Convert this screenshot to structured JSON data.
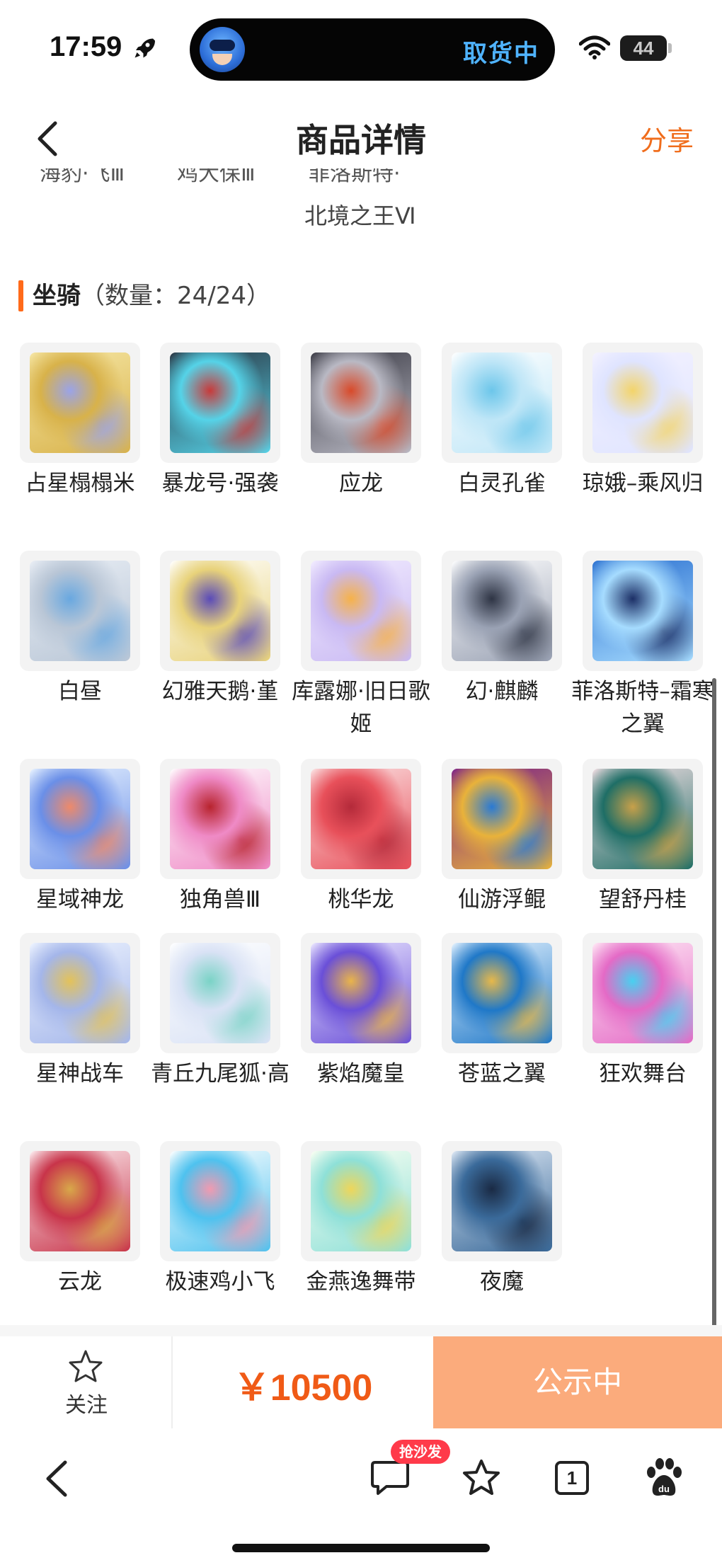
{
  "status_bar": {
    "time": "17:59",
    "island_text": "取货中",
    "battery": "44"
  },
  "nav": {
    "title": "商品详情",
    "share_label": "分享"
  },
  "previous_section": {
    "cut_items": [
      "海豹·飞Ⅲ",
      "鸡大保Ⅲ",
      "菲洛斯特·"
    ],
    "last_line": "北境之王Ⅵ"
  },
  "section": {
    "title": "坐骑",
    "count_label": "（数量：",
    "count": "24/24",
    "count_close": "）"
  },
  "mounts": [
    {
      "name": "占星榻榻米",
      "colors": [
        "#f6e7a6",
        "#d8b24a",
        "#9aa3e8"
      ]
    },
    {
      "name": "暴龙号·强袭",
      "colors": [
        "#2a3340",
        "#55d3e8",
        "#c83a3a"
      ]
    },
    {
      "name": "应龙",
      "colors": [
        "#3a3a44",
        "#b9b9c4",
        "#d84a2a"
      ]
    },
    {
      "name": "白灵孔雀",
      "colors": [
        "#ffffff",
        "#bfe6f7",
        "#6cc6ea"
      ]
    },
    {
      "name": "琼娥–乘风归",
      "colors": [
        "#f4f2ff",
        "#dfe4ff",
        "#f3d46a"
      ]
    },
    {
      "name": "白昼",
      "colors": [
        "#e9eef5",
        "#b9c6d6",
        "#69a8e0"
      ]
    },
    {
      "name": "幻雅天鹅·堇",
      "colors": [
        "#ffffff",
        "#e8d27a",
        "#5a4bb8"
      ]
    },
    {
      "name": "库露娜·旧日歌姬",
      "colors": [
        "#f2ecff",
        "#c9b9f3",
        "#f6b24a"
      ]
    },
    {
      "name": "幻·麒麟",
      "colors": [
        "#ffffff",
        "#9aa2b4",
        "#2e3444"
      ]
    },
    {
      "name": "菲洛斯特–霜寒之翼",
      "colors": [
        "#2a6fd0",
        "#a6dcff",
        "#1c2f66"
      ]
    },
    {
      "name": "星域神龙",
      "colors": [
        "#e7f2ff",
        "#6a8fe8",
        "#ee8a6a"
      ]
    },
    {
      "name": "独角兽Ⅲ",
      "colors": [
        "#ffffff",
        "#ef8ac6",
        "#b8242e"
      ]
    },
    {
      "name": "桃华龙",
      "colors": [
        "#fbe3e4",
        "#e8505a",
        "#b42a3a"
      ]
    },
    {
      "name": "仙游浮鲲",
      "colors": [
        "#7a1f8a",
        "#e9b23a",
        "#2a7ad4"
      ]
    },
    {
      "name": "望舒丹桂",
      "colors": [
        "#f3dfe4",
        "#1e6e66",
        "#c8a04a"
      ]
    },
    {
      "name": "星神战车",
      "colors": [
        "#eef4ff",
        "#a4b6ea",
        "#e3c25a"
      ]
    },
    {
      "name": "青丘九尾狐·高",
      "colors": [
        "#ffffff",
        "#d9e2f5",
        "#7ad3c6"
      ]
    },
    {
      "name": "紫焰魔皇",
      "colors": [
        "#ece8ff",
        "#6a4fd8",
        "#e9b44a"
      ]
    },
    {
      "name": "苍蓝之翼",
      "colors": [
        "#e5f3ff",
        "#1f78c8",
        "#e7b84a"
      ]
    },
    {
      "name": "狂欢舞台",
      "colors": [
        "#ffe9f5",
        "#e46ac6",
        "#48d0f0"
      ]
    },
    {
      "name": "云龙",
      "colors": [
        "#fdeef1",
        "#c8344a",
        "#d8a84a"
      ]
    },
    {
      "name": "极速鸡小飞",
      "colors": [
        "#ffffff",
        "#4ec2ef",
        "#f19ab0"
      ]
    },
    {
      "name": "金燕逸舞带",
      "colors": [
        "#fbfff2",
        "#8ee0d8",
        "#eed65a"
      ]
    },
    {
      "name": "夜魔",
      "colors": [
        "#dfe9f5",
        "#3a6a9a",
        "#1a2a44"
      ]
    }
  ],
  "action_bar": {
    "follow_label": "关注",
    "price": "￥10500",
    "status_button": "公示中"
  },
  "browser_bar": {
    "comment_badge": "抢沙发",
    "tab_count": "1"
  }
}
